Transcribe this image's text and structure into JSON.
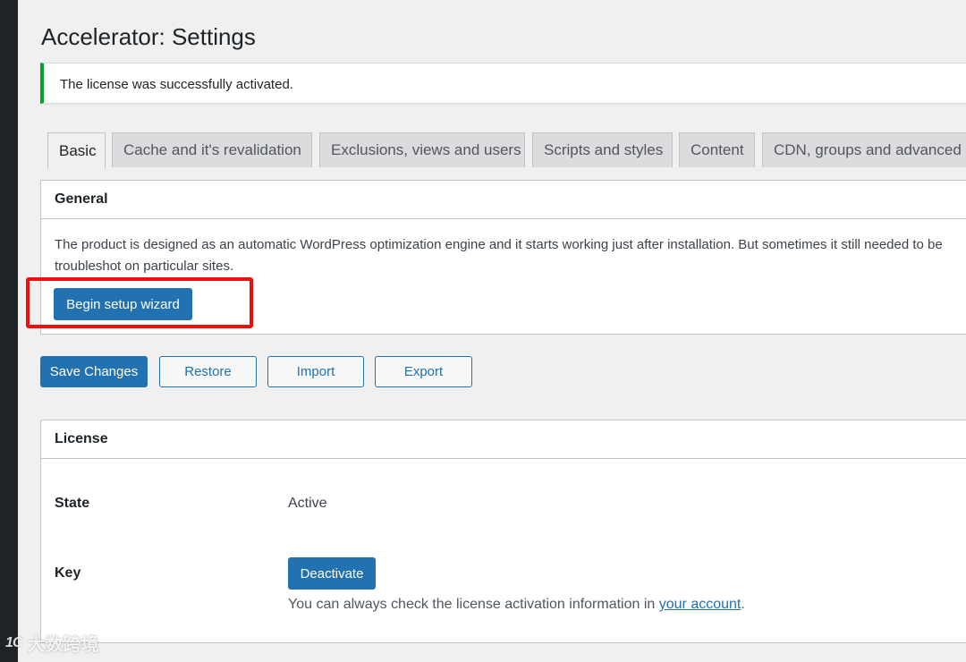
{
  "page": {
    "title": "Accelerator: Settings"
  },
  "notice": {
    "text": "The license was successfully activated.",
    "color": "#00a32a"
  },
  "tabs": [
    {
      "label": "Basic",
      "active": true
    },
    {
      "label": "Cache and it's revalidation",
      "active": false
    },
    {
      "label": "Exclusions, views and users",
      "active": false
    },
    {
      "label": "Scripts and styles",
      "active": false
    },
    {
      "label": "Content",
      "active": false
    },
    {
      "label": "CDN, groups and advanced",
      "active": false
    }
  ],
  "general": {
    "heading": "General",
    "description": "The product is designed as an automatic WordPress optimization engine and it starts working just after installation. But sometimes it still needed to be troubleshot on particular sites.",
    "wizard_button": "Begin setup wizard"
  },
  "actions": {
    "save": "Save Changes",
    "restore": "Restore",
    "import": "Import",
    "export": "Export"
  },
  "license": {
    "heading": "License",
    "state_label": "State",
    "state_value": "Active",
    "key_label": "Key",
    "deactivate_button": "Deactivate",
    "help_prefix": "You can always check the license activation information in ",
    "help_link": "your account",
    "help_suffix": "."
  },
  "watermark": {
    "mark": "1C",
    "text": "大数跨境"
  },
  "colors": {
    "primary": "#2271b1",
    "highlight": "#f20d0d",
    "admin_bar": "#1d2327"
  }
}
